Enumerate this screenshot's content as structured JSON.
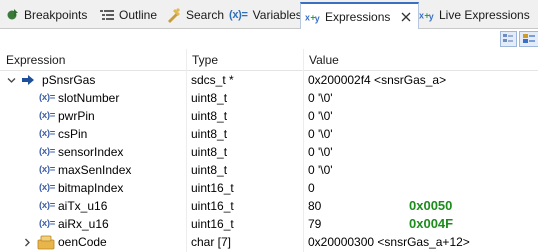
{
  "tabs": [
    {
      "label": "Breakpoints",
      "icon": "breakpoints-icon"
    },
    {
      "label": "Outline",
      "icon": "outline-icon"
    },
    {
      "label": "Search",
      "icon": "search-icon"
    },
    {
      "label": "Variables",
      "icon": "variables-icon",
      "prefix": "(x)="
    },
    {
      "label": "Expressions",
      "icon": "expressions-icon",
      "active": true
    },
    {
      "label": "Live Expressions",
      "icon": "live-expressions-icon"
    }
  ],
  "columns": {
    "expression": "Expression",
    "type": "Type",
    "value": "Value"
  },
  "rows": [
    {
      "name": "pSnsrGas",
      "type": "sdcs_t *",
      "value": "0x200002f4 <snsrGas_a>",
      "kind": "pointer",
      "expanded": true
    },
    {
      "name": "slotNumber",
      "type": "uint8_t",
      "value": "0 '\\0'",
      "kind": "field"
    },
    {
      "name": "pwrPin",
      "type": "uint8_t",
      "value": "0 '\\0'",
      "kind": "field"
    },
    {
      "name": "csPin",
      "type": "uint8_t",
      "value": "0 '\\0'",
      "kind": "field"
    },
    {
      "name": "sensorIndex",
      "type": "uint8_t",
      "value": "0 '\\0'",
      "kind": "field"
    },
    {
      "name": "maxSenIndex",
      "type": "uint8_t",
      "value": "0 '\\0'",
      "kind": "field"
    },
    {
      "name": "bitmapIndex",
      "type": "uint16_t",
      "value": "0",
      "kind": "field"
    },
    {
      "name": "aiTx_u16",
      "type": "uint16_t",
      "value": "80",
      "kind": "field",
      "note": "0x0050"
    },
    {
      "name": "aiRx_u16",
      "type": "uint16_t",
      "value": "79",
      "kind": "field",
      "note": "0x004F"
    },
    {
      "name": "oenCode",
      "type": "char [7]",
      "value": "0x20000300 <snsrGas_a+12>",
      "kind": "array",
      "collapsed": true
    }
  ],
  "variable_badge": "(x)=",
  "colors": {
    "accent": "#3b6fc4",
    "note_green": "#1d8c1d",
    "badge_blue": "#3d5fa8"
  }
}
